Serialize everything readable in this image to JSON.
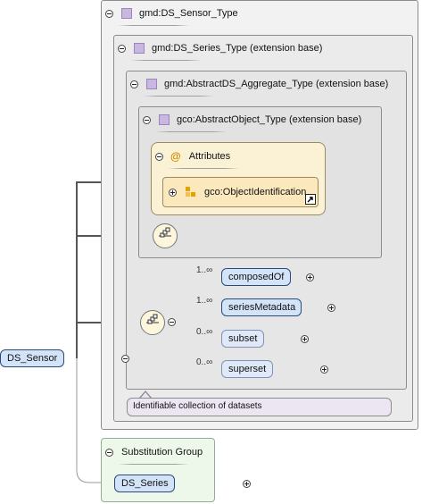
{
  "root_element": {
    "label": "DS_Sensor"
  },
  "types": {
    "sensor_type": "gmd:DS_Sensor_Type",
    "series_type": "gmd:DS_Series_Type (extension base)",
    "aggregate_type": "gmd:AbstractDS_Aggregate_Type (extension base)",
    "object_type": "gco:AbstractObject_Type (extension base)"
  },
  "attributes": {
    "title": "Attributes",
    "group": "gco:ObjectIdentification"
  },
  "sequence_children": [
    {
      "name": "composedOf",
      "occurs": "1..∞",
      "optional": false
    },
    {
      "name": "seriesMetadata",
      "occurs": "1..∞",
      "optional": false
    },
    {
      "name": "subset",
      "occurs": "0..∞",
      "optional": true
    },
    {
      "name": "superset",
      "occurs": "0..∞",
      "optional": true
    }
  ],
  "documentation": "Identifiable collection of datasets",
  "substitution_group": {
    "title": "Substitution Group",
    "member": "DS_Series"
  },
  "colors": {
    "element_fill": "#d4e4f8",
    "element_border": "#2a4a7a",
    "type_icon": "#c8b8e0",
    "attribute_fill": "#fbf2d6",
    "substitution_fill": "#eef8ea"
  }
}
